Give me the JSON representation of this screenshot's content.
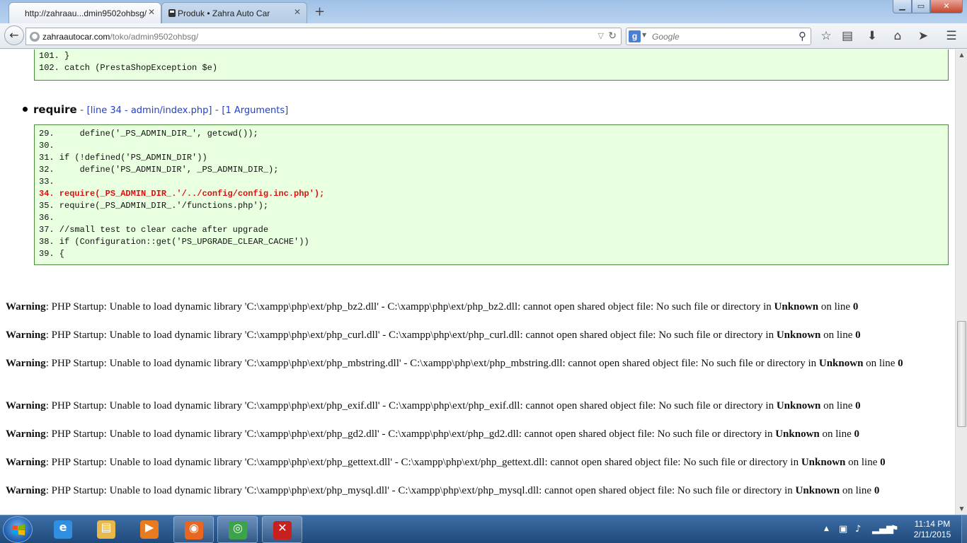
{
  "browser": {
    "tabs": [
      {
        "label": "http://zahraau...dmin9502ohbsg/",
        "active": true
      },
      {
        "label": "Produk • Zahra Auto Car",
        "active": false
      }
    ],
    "new_tab_glyph": "+",
    "url_host": "zahraautocar.com",
    "url_path": "/toko/admin9502ohbsg/",
    "search_placeholder": "Google",
    "search_engine_letter": "g"
  },
  "code_box_1": {
    "lines": [
      "101. }",
      "102. catch (PrestaShopException $e)"
    ]
  },
  "trace": {
    "function": "require",
    "separator": " - ",
    "location_link": "[line 34 - admin/index.php]",
    "args_link": "[1 Arguments]"
  },
  "code_box_2": {
    "lines": [
      {
        "text": "29.     define('_PS_ADMIN_DIR_', getcwd());",
        "highlight": false
      },
      {
        "text": "30.",
        "highlight": false
      },
      {
        "text": "31. if (!defined('PS_ADMIN_DIR'))",
        "highlight": false
      },
      {
        "text": "32.     define('PS_ADMIN_DIR', _PS_ADMIN_DIR_);",
        "highlight": false
      },
      {
        "text": "33.",
        "highlight": false
      },
      {
        "text": "34. require(_PS_ADMIN_DIR_.'/../config/config.inc.php');",
        "highlight": true
      },
      {
        "text": "35. require(_PS_ADMIN_DIR_.'/functions.php');",
        "highlight": false
      },
      {
        "text": "36.",
        "highlight": false
      },
      {
        "text": "37. //small test to clear cache after upgrade",
        "highlight": false
      },
      {
        "text": "38. if (Configuration::get('PS_UPGRADE_CLEAR_CACHE'))",
        "highlight": false
      },
      {
        "text": "39. {",
        "highlight": false
      }
    ]
  },
  "warnings": [
    {
      "label": "Warning",
      "msg": ": PHP Startup: Unable to load dynamic library 'C:\\xampp\\php\\ext/php_bz2.dll' - C:\\xampp\\php\\ext/php_bz2.dll: cannot open shared object file: No such file or directory in ",
      "where": "Unknown",
      "online": " on line ",
      "line": "0"
    },
    {
      "label": "Warning",
      "msg": ": PHP Startup: Unable to load dynamic library 'C:\\xampp\\php\\ext/php_curl.dll' - C:\\xampp\\php\\ext/php_curl.dll: cannot open shared object file: No such file or directory in ",
      "where": "Unknown",
      "online": " on line ",
      "line": "0"
    },
    {
      "label": "Warning",
      "msg": ": PHP Startup: Unable to load dynamic library 'C:\\xampp\\php\\ext/php_mbstring.dll' - C:\\xampp\\php\\ext/php_mbstring.dll: cannot open shared object file: No such file or directory in ",
      "where": "Unknown",
      "online": " on line ",
      "line": "0"
    },
    {
      "label": "Warning",
      "msg": ": PHP Startup: Unable to load dynamic library 'C:\\xampp\\php\\ext/php_exif.dll' - C:\\xampp\\php\\ext/php_exif.dll: cannot open shared object file: No such file or directory in ",
      "where": "Unknown",
      "online": " on line ",
      "line": "0"
    },
    {
      "label": "Warning",
      "msg": ": PHP Startup: Unable to load dynamic library 'C:\\xampp\\php\\ext/php_gd2.dll' - C:\\xampp\\php\\ext/php_gd2.dll: cannot open shared object file: No such file or directory in ",
      "where": "Unknown",
      "online": " on line ",
      "line": "0"
    },
    {
      "label": "Warning",
      "msg": ": PHP Startup: Unable to load dynamic library 'C:\\xampp\\php\\ext/php_gettext.dll' - C:\\xampp\\php\\ext/php_gettext.dll: cannot open shared object file: No such file or directory in ",
      "where": "Unknown",
      "online": " on line ",
      "line": "0"
    },
    {
      "label": "Warning",
      "msg": ": PHP Startup: Unable to load dynamic library 'C:\\xampp\\php\\ext/php_mysql.dll' - C:\\xampp\\php\\ext/php_mysql.dll: cannot open shared object file: No such file or directory in ",
      "where": "Unknown",
      "online": " on line ",
      "line": "0"
    }
  ],
  "taskbar": {
    "apps": [
      {
        "name": "internet-explorer-icon",
        "glyph": "e",
        "color": "#2f8fe0"
      },
      {
        "name": "file-explorer-icon",
        "glyph": "▤",
        "color": "#e8b84a"
      },
      {
        "name": "media-player-icon",
        "glyph": "▶",
        "color": "#e87a1f"
      },
      {
        "name": "firefox-icon",
        "glyph": "◉",
        "color": "#e8661f"
      },
      {
        "name": "chrome-icon",
        "glyph": "◎",
        "color": "#3ca34a"
      },
      {
        "name": "app-red-icon",
        "glyph": "✕",
        "color": "#c8201f"
      }
    ],
    "time": "11:14 PM",
    "date": "2/11/2015"
  },
  "colors": {
    "code_bg": "#e8ffe0",
    "code_highlight": "#e01010",
    "link": "#2040d0"
  }
}
